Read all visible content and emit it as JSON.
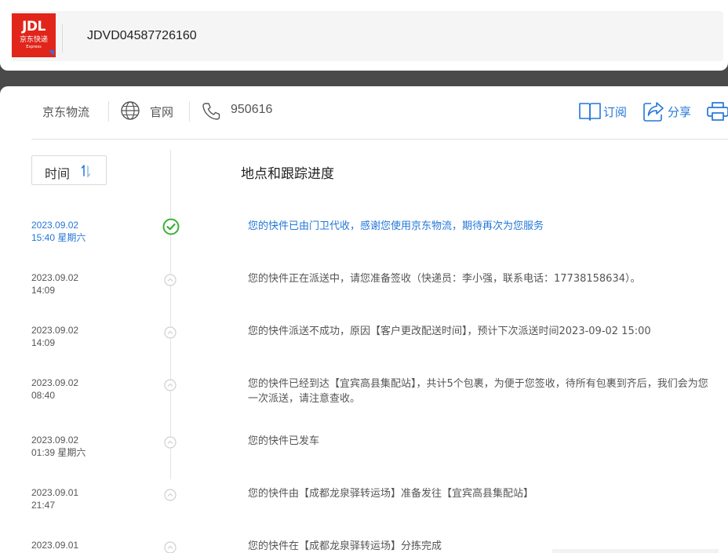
{
  "header": {
    "logo": {
      "main": "JDL",
      "cn": "京东快递",
      "en": "Express"
    },
    "tracking_number": "JDVD04587726160"
  },
  "carrier": {
    "name": "京东物流",
    "site_label": "官网",
    "phone": "950616"
  },
  "actions": {
    "subscribe_label": "订阅",
    "share_label": "分享"
  },
  "sort": {
    "label": "时间"
  },
  "section_heading": "地点和跟踪进度",
  "colors": {
    "accent": "#2477d8",
    "success": "#3cb034",
    "brand": "#e1251b"
  },
  "timeline": [
    {
      "date": "2023.09.02",
      "time": "15:40 星期六",
      "text": "您的快件已由门卫代收，感谢您使用京东物流，期待再次为您服务",
      "status": "delivered"
    },
    {
      "date": "2023.09.02",
      "time": "14:09",
      "text": "您的快件正在派送中，请您准备签收（快递员：李小强，联系电话：17738158634）。",
      "status": "normal"
    },
    {
      "date": "2023.09.02",
      "time": "14:09",
      "text": "您的快件派送不成功，原因【客户更改配送时间】，预计下次派送时间2023-09-02 15:00",
      "status": "normal"
    },
    {
      "date": "2023.09.02",
      "time": "08:40",
      "text": "您的快件已经到达【宜宾高县集配站】，共计5个包裹，为便于您签收，待所有包裹到齐后，我们会为您一次派送，请注意查收。",
      "status": "normal"
    },
    {
      "date": "2023.09.02",
      "time": "01:39 星期六",
      "text": "您的快件已发车",
      "status": "normal"
    },
    {
      "date": "2023.09.01",
      "time": "21:47",
      "text": "您的快件由【成都龙泉驿转运场】准备发往【宜宾高县集配站】",
      "status": "normal"
    },
    {
      "date": "2023.09.01",
      "time": "",
      "text": "您的快件在【成都龙泉驿转运场】分拣完成",
      "status": "normal"
    }
  ]
}
